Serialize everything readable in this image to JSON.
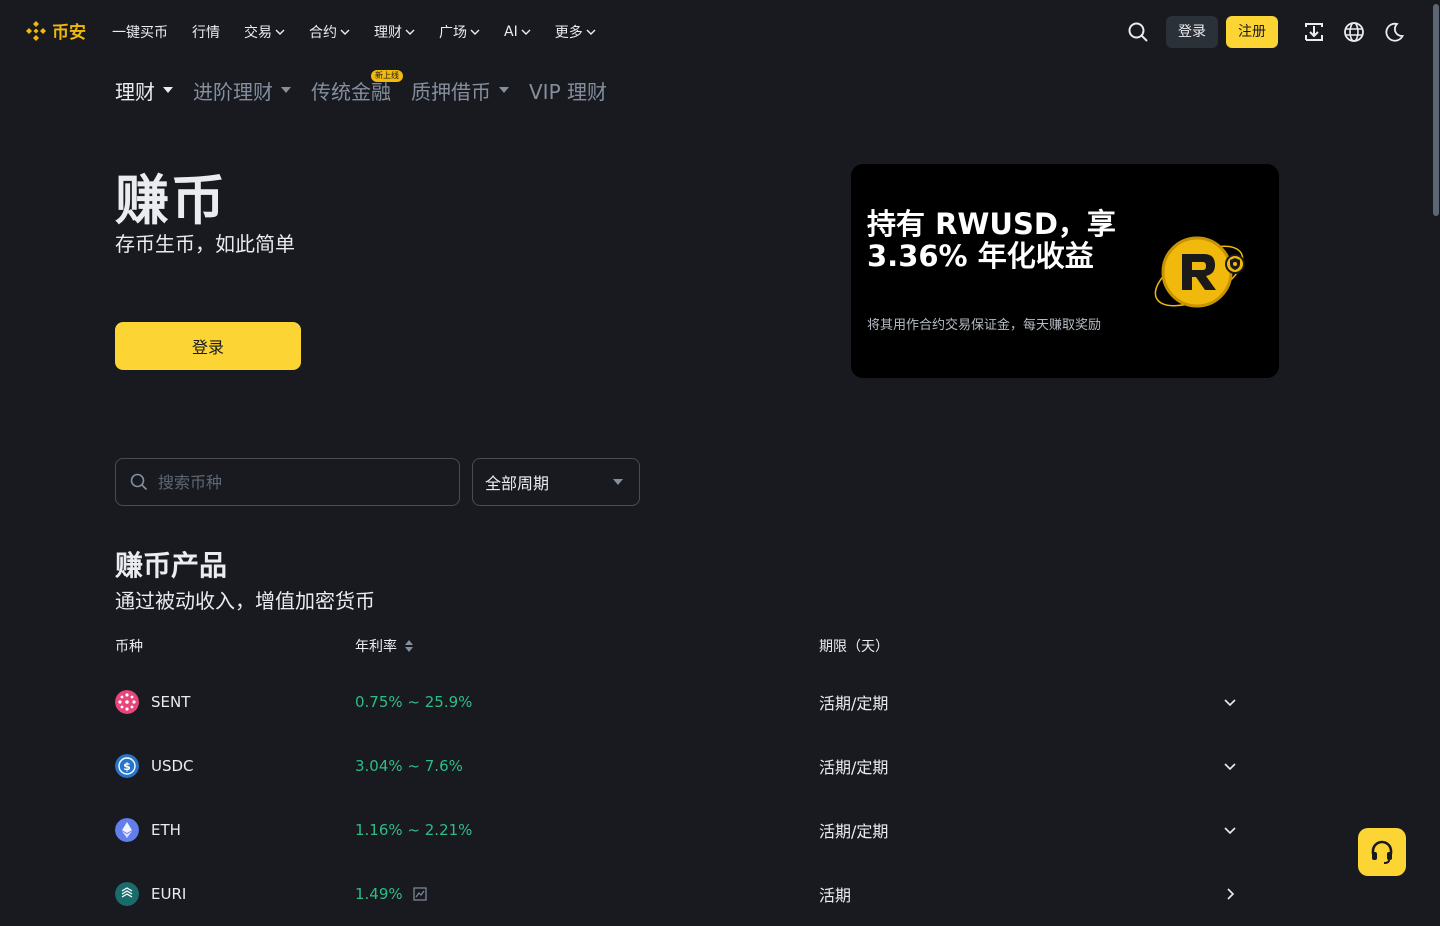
{
  "nav": {
    "logo_text": "币安",
    "items": [
      {
        "label": "一键买币",
        "has_menu": false
      },
      {
        "label": "行情",
        "has_menu": false
      },
      {
        "label": "交易",
        "has_menu": true
      },
      {
        "label": "合约",
        "has_menu": true
      },
      {
        "label": "理财",
        "has_menu": true
      },
      {
        "label": "广场",
        "has_menu": true
      },
      {
        "label": "AI",
        "has_menu": true
      },
      {
        "label": "更多",
        "has_menu": true
      }
    ],
    "login_label": "登录",
    "register_label": "注册",
    "icons": [
      "search-icon",
      "download-icon",
      "globe-icon",
      "moon-icon"
    ]
  },
  "subtabs": [
    {
      "label": "理财",
      "active": true,
      "has_menu": true
    },
    {
      "label": "进阶理财",
      "active": false,
      "has_menu": true
    },
    {
      "label": "传统金融",
      "active": false,
      "has_menu": false,
      "badge": "新上线"
    },
    {
      "label": "质押借币",
      "active": false,
      "has_menu": true
    },
    {
      "label": "VIP 理财",
      "active": false,
      "has_menu": false
    }
  ],
  "hero": {
    "title": "赚币",
    "subtitle": "存币生币，如此简单",
    "login_label": "登录"
  },
  "banner": {
    "title": "持有 RWUSD，享 3.36% 年化收益",
    "subtitle": "将其用作合约交易保证金，每天赚取奖励"
  },
  "filters": {
    "search_placeholder": "搜索币种",
    "period_selected": "全部周期"
  },
  "products": {
    "title": "赚币产品",
    "subtitle": "通过被动收入，增值加密货币",
    "headers": {
      "coin": "币种",
      "apy": "年利率",
      "term": "期限（天）"
    },
    "rows": [
      {
        "coin": "SENT",
        "apy": "0.75% ~ 25.9%",
        "term": "活期/定期",
        "icon_color": "#e8457a",
        "expand": "chevron-down"
      },
      {
        "coin": "USDC",
        "apy": "3.04% ~ 7.6%",
        "term": "活期/定期",
        "icon_color": "#2775ca",
        "expand": "chevron-down"
      },
      {
        "coin": "ETH",
        "apy": "1.16% ~ 2.21%",
        "term": "活期/定期",
        "icon_color": "#627eea",
        "expand": "chevron-down"
      },
      {
        "coin": "EURI",
        "apy": "1.49%",
        "term": "活期",
        "icon_color": "#1a6b6b",
        "expand": "chevron-right",
        "has_chart_icon": true
      }
    ]
  },
  "colors": {
    "background": "#181a20",
    "brand_yellow": "#fcd535",
    "positive_green": "#2ebd85",
    "muted_text": "#848e9c"
  }
}
